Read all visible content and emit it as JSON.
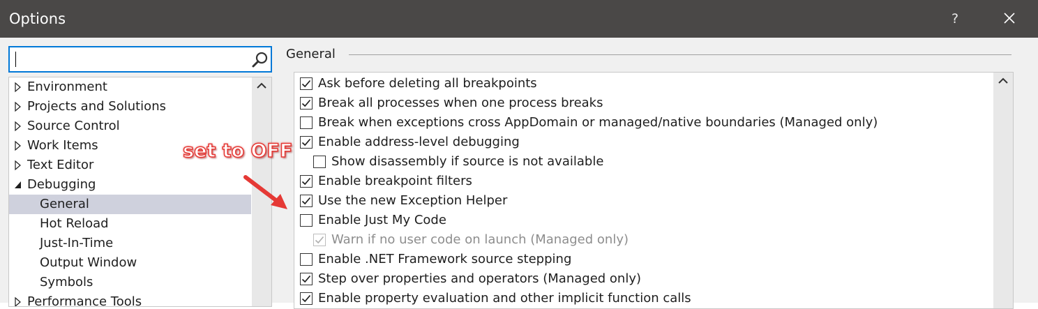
{
  "window": {
    "title": "Options",
    "help_label": "?",
    "title_bar_color": "#4a4847"
  },
  "search": {
    "value": "",
    "placeholder": "",
    "icon": "magnifier-icon"
  },
  "tree": {
    "items": [
      {
        "label": "Environment",
        "expander": "collapsed"
      },
      {
        "label": "Projects and Solutions",
        "expander": "collapsed"
      },
      {
        "label": "Source Control",
        "expander": "collapsed"
      },
      {
        "label": "Work Items",
        "expander": "collapsed"
      },
      {
        "label": "Text Editor",
        "expander": "collapsed"
      },
      {
        "label": "Debugging",
        "expander": "expanded"
      },
      {
        "label": "General",
        "selected": true
      },
      {
        "label": "Hot Reload"
      },
      {
        "label": "Just-In-Time"
      },
      {
        "label": "Output Window"
      },
      {
        "label": "Symbols"
      },
      {
        "label": "Performance Tools",
        "expander": "collapsed"
      }
    ],
    "selected_color": "#cfd1dd"
  },
  "group": {
    "title": "General"
  },
  "options": [
    {
      "label": "Ask before deleting all breakpoints",
      "checked": true,
      "level": 0,
      "enabled": true
    },
    {
      "label": "Break all processes when one process breaks",
      "checked": true,
      "level": 0,
      "enabled": true
    },
    {
      "label": "Break when exceptions cross AppDomain or managed/native boundaries (Managed only)",
      "checked": false,
      "level": 0,
      "enabled": true
    },
    {
      "label": "Enable address-level debugging",
      "checked": true,
      "level": 0,
      "enabled": true
    },
    {
      "label": "Show disassembly if source is not available",
      "checked": false,
      "level": 1,
      "enabled": true
    },
    {
      "label": "Enable breakpoint filters",
      "checked": true,
      "level": 0,
      "enabled": true
    },
    {
      "label": "Use the new Exception Helper",
      "checked": true,
      "level": 0,
      "enabled": true
    },
    {
      "label": "Enable Just My Code",
      "checked": false,
      "level": 0,
      "enabled": true
    },
    {
      "label": "Warn if no user code on launch (Managed only)",
      "checked": true,
      "level": 1,
      "enabled": false
    },
    {
      "label": "Enable .NET Framework source stepping",
      "checked": false,
      "level": 0,
      "enabled": true
    },
    {
      "label": "Step over properties and operators (Managed only)",
      "checked": true,
      "level": 0,
      "enabled": true
    },
    {
      "label": "Enable property evaluation and other implicit function calls",
      "checked": true,
      "level": 0,
      "enabled": true
    }
  ],
  "annotation": {
    "text": "set to OFF",
    "color": "#e53935"
  }
}
